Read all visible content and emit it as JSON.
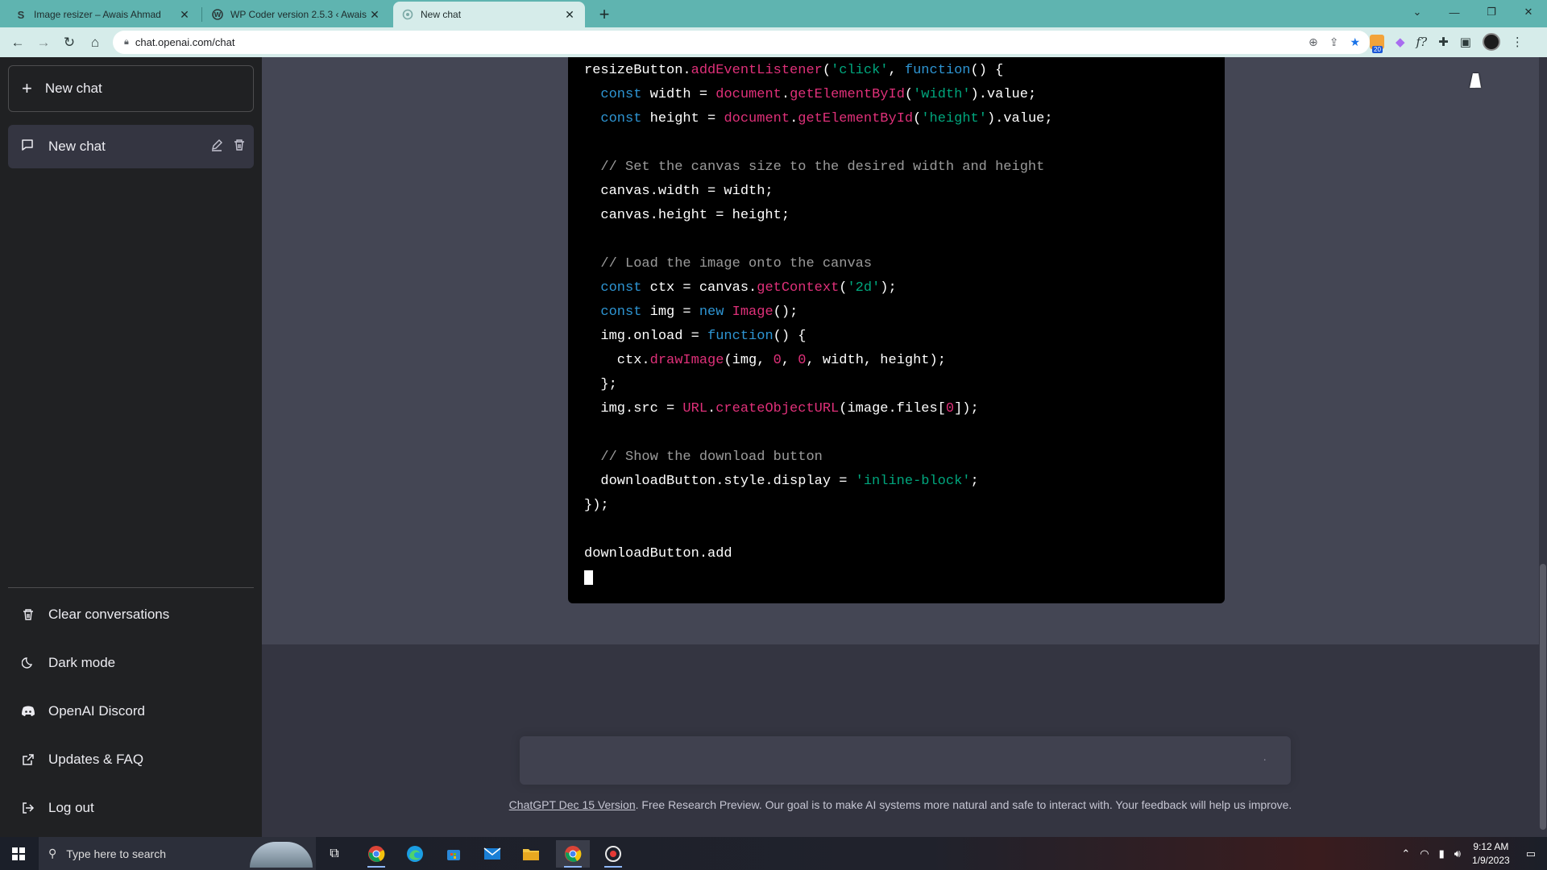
{
  "browser": {
    "tabs": [
      {
        "title": "Image resizer – Awais Ahmad",
        "favicon": "S"
      },
      {
        "title": "WP Coder version 2.5.3 ‹ Awais A",
        "favicon": "wordpress-icon"
      },
      {
        "title": "New chat",
        "favicon": "openai-icon",
        "active": true
      }
    ],
    "url": "chat.openai.com/chat",
    "extension_badge": "20"
  },
  "sidebar": {
    "new_chat_label": "New chat",
    "conversations": [
      {
        "title": "New chat"
      }
    ],
    "links": [
      {
        "label": "Clear conversations",
        "icon": "trash-icon"
      },
      {
        "label": "Dark mode",
        "icon": "moon-icon"
      },
      {
        "label": "OpenAI Discord",
        "icon": "discord-icon"
      },
      {
        "label": "Updates & FAQ",
        "icon": "external-link-icon"
      },
      {
        "label": "Log out",
        "icon": "logout-icon"
      }
    ]
  },
  "code_lines": [
    [
      [
        "",
        "resizeButton."
      ],
      [
        "fn",
        "addEventListener"
      ],
      [
        "",
        "("
      ],
      [
        "st",
        "'click'"
      ],
      [
        "",
        ", "
      ],
      [
        "kw",
        "function"
      ],
      [
        "",
        "() {"
      ]
    ],
    [
      [
        "",
        "  "
      ],
      [
        "kw",
        "const"
      ],
      [
        "",
        " width = "
      ],
      [
        "fn",
        "document"
      ],
      [
        "",
        "."
      ],
      [
        "fn",
        "getElementById"
      ],
      [
        "",
        "("
      ],
      [
        "st",
        "'width'"
      ],
      [
        "",
        ").value;"
      ]
    ],
    [
      [
        "",
        "  "
      ],
      [
        "kw",
        "const"
      ],
      [
        "",
        " height = "
      ],
      [
        "fn",
        "document"
      ],
      [
        "",
        "."
      ],
      [
        "fn",
        "getElementById"
      ],
      [
        "",
        "("
      ],
      [
        "st",
        "'height'"
      ],
      [
        "",
        ").value;"
      ]
    ],
    [
      [
        "",
        ""
      ]
    ],
    [
      [
        "cm",
        "  // Set the canvas size to the desired width and height"
      ]
    ],
    [
      [
        "",
        "  canvas.width = width;"
      ]
    ],
    [
      [
        "",
        "  canvas.height = height;"
      ]
    ],
    [
      [
        "",
        ""
      ]
    ],
    [
      [
        "cm",
        "  // Load the image onto the canvas"
      ]
    ],
    [
      [
        "",
        "  "
      ],
      [
        "kw",
        "const"
      ],
      [
        "",
        " ctx = canvas."
      ],
      [
        "fn",
        "getContext"
      ],
      [
        "",
        "("
      ],
      [
        "st",
        "'2d'"
      ],
      [
        "",
        ");"
      ]
    ],
    [
      [
        "",
        "  "
      ],
      [
        "kw",
        "const"
      ],
      [
        "",
        " img = "
      ],
      [
        "kw",
        "new"
      ],
      [
        "",
        " "
      ],
      [
        "fn",
        "Image"
      ],
      [
        "",
        "();"
      ]
    ],
    [
      [
        "",
        "  img.onload = "
      ],
      [
        "kw",
        "function"
      ],
      [
        "",
        "() {"
      ]
    ],
    [
      [
        "",
        "    ctx."
      ],
      [
        "fn",
        "drawImage"
      ],
      [
        "",
        "(img, "
      ],
      [
        "fn",
        "0"
      ],
      [
        "",
        ", "
      ],
      [
        "fn",
        "0"
      ],
      [
        "",
        ", width, height);"
      ]
    ],
    [
      [
        "",
        "  };"
      ]
    ],
    [
      [
        "",
        "  img.src = "
      ],
      [
        "fn",
        "URL"
      ],
      [
        "",
        "."
      ],
      [
        "fn",
        "createObjectURL"
      ],
      [
        "",
        "(image.files["
      ],
      [
        "fn",
        "0"
      ],
      [
        "",
        "]);"
      ]
    ],
    [
      [
        "",
        ""
      ]
    ],
    [
      [
        "cm",
        "  // Show the download button"
      ]
    ],
    [
      [
        "",
        "  downloadButton.style.display = "
      ],
      [
        "st",
        "'inline-block'"
      ],
      [
        "",
        ";"
      ]
    ],
    [
      [
        "",
        "});"
      ]
    ],
    [
      [
        "",
        ""
      ]
    ],
    [
      [
        "",
        "downloadButton.add"
      ]
    ]
  ],
  "footer": {
    "version_link": "ChatGPT Dec 15 Version",
    "note": ". Free Research Preview. Our goal is to make AI systems more natural and safe to interact with. Your feedback will help us improve."
  },
  "taskbar": {
    "search_placeholder": "Type here to search",
    "time": "9:12 AM",
    "date": "1/9/2023"
  },
  "colors": {
    "sidebar_bg": "#202123",
    "main_bg": "#444654",
    "code_keyword": "#2e95d3",
    "code_function": "#df3079",
    "code_string": "#00a67d"
  }
}
